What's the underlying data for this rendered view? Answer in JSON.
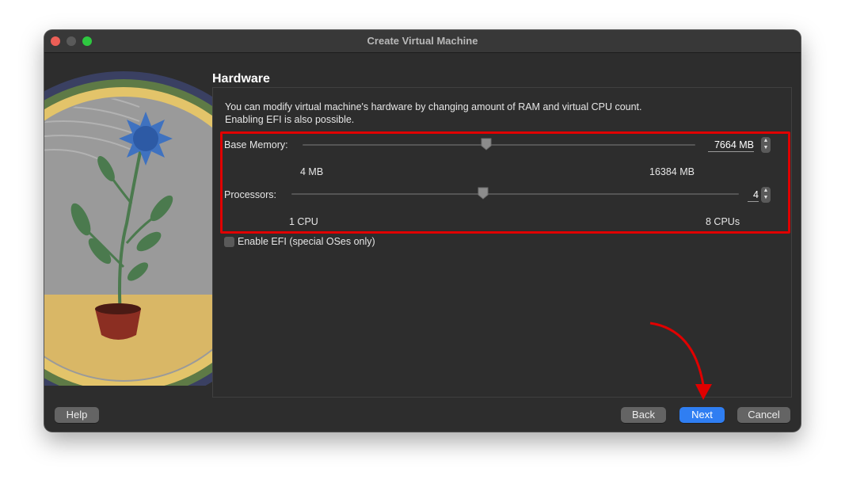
{
  "window": {
    "title": "Create Virtual Machine"
  },
  "page": {
    "heading": "Hardware",
    "description_line1": "You can modify virtual machine's hardware by changing amount of RAM and virtual CPU count.",
    "description_line2": "Enabling EFI is also possible."
  },
  "memory": {
    "label": "Base Memory:",
    "value": 7664,
    "value_text": "7664 MB",
    "min_label": "4 MB",
    "max_label": "16384 MB",
    "min": 4,
    "max": 16384
  },
  "processors": {
    "label": "Processors:",
    "value": 4,
    "value_text": "4",
    "min_label": "1 CPU",
    "max_label": "8 CPUs",
    "min": 1,
    "max": 8
  },
  "efi": {
    "label": "Enable EFI (special OSes only)",
    "checked": false
  },
  "buttons": {
    "help": "Help",
    "back": "Back",
    "next": "Next",
    "cancel": "Cancel"
  },
  "colors": {
    "annotation": "#e00000",
    "primary_button": "#2f7ef2"
  }
}
